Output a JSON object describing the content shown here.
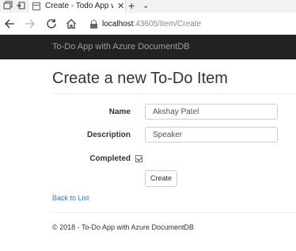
{
  "browser": {
    "tab": {
      "title": "Create - Todo App with",
      "close_glyph": "✕"
    },
    "new_tab_glyph": "+",
    "tab_menu_glyph": "⌄",
    "icons": {
      "tab_preview": "tab-preview-icon",
      "set_aside": "set-aside-tabs-icon",
      "back": "back-arrow-icon",
      "forward": "forward-arrow-icon",
      "refresh": "refresh-icon",
      "home": "home-icon",
      "lock": "lock-icon"
    },
    "address": {
      "host": "localhost",
      "rest": ":43605/Item/Create"
    }
  },
  "site": {
    "brand": "To-Do App with Azure DocumentDB"
  },
  "main": {
    "title": "Create a new To-Do Item",
    "form": {
      "name_label": "Name",
      "name_value": "Akshay Patel",
      "description_label": "Description",
      "description_value": "Speaker",
      "completed_label": "Completed",
      "completed_checked": true,
      "submit_label": "Create"
    },
    "back_link": "Back to List",
    "footer": "© 2018 - To-Do App with Azure DocumentDB"
  }
}
